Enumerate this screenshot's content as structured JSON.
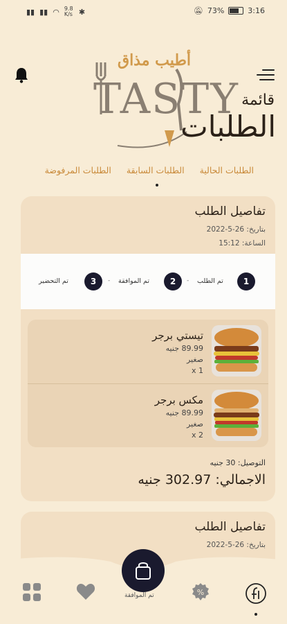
{
  "status_bar": {
    "left_text": "9.8 K/s",
    "battery": "73%",
    "time": "3:16"
  },
  "logo": {
    "arabic": "أطيب مذاق",
    "english": "TASTY"
  },
  "header": {
    "title_line1": "قائمة",
    "title_line2": "الطلبات"
  },
  "tabs": [
    {
      "label": "الطلبات الحالية"
    },
    {
      "label": "الطلبات السابقة"
    },
    {
      "label": "الطلبات المرفوضة"
    }
  ],
  "order": {
    "title": "تفاصيل الطلب",
    "date": "بتاريخ: 26-5-2022",
    "time": "الساعة: 15:12",
    "steps": [
      {
        "num": "1",
        "label": "تم الطلب"
      },
      {
        "num": "2",
        "label": "تم الموافقة"
      },
      {
        "num": "3",
        "label": "تم التحضير"
      }
    ],
    "items": [
      {
        "name": "تيستي برجر",
        "price": "89.99 جنيه",
        "size": "صغير",
        "qty": "x 1"
      },
      {
        "name": "مكس برجر",
        "price": "89.99 جنيه",
        "size": "صغير",
        "qty": "x 2"
      }
    ],
    "delivery": "التوصيل: 30 جنيه",
    "total": "الاجمالي: 302.97 جنيه"
  },
  "order2": {
    "title": "تفاصيل الطلب",
    "date": "بتاريخ: 26-5-2022"
  },
  "bottom_nav": {
    "cart_label": "تم الموافقة"
  },
  "colors": {
    "background": "#f8ecd6",
    "card": "#f2dfc4",
    "accent": "#c98a3a",
    "dark": "#1a1a2e"
  }
}
